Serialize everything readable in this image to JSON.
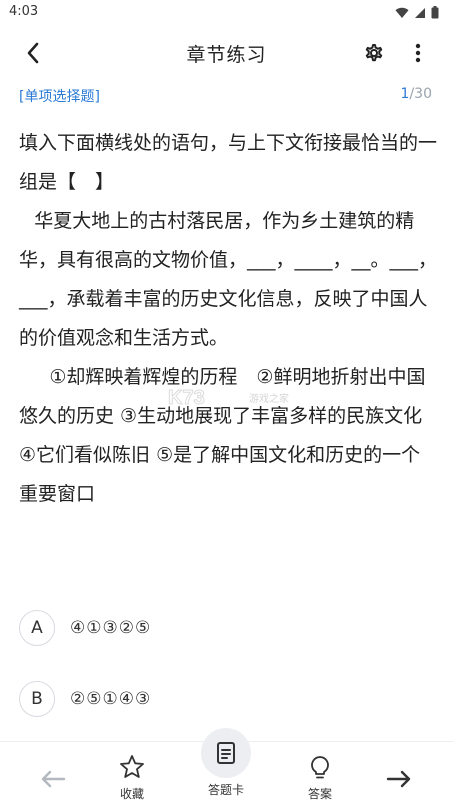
{
  "status_bar": {
    "time": "4:03"
  },
  "header": {
    "title": "章节练习"
  },
  "meta": {
    "question_type": "[单项选择题]",
    "current": "1",
    "total": "/30"
  },
  "question": {
    "paragraphs": [
      "填入下面横线处的语句，与上下文衔接最恰当的一组是【　】",
      "华夏大地上的古村落民居，作为乡土建筑的精华，具有很高的文物价值，___，____，__。___，___，承载着丰富的历史文化信息，反映了中国人的价值观念和生活方式。",
      "①却辉映着辉煌的历程　②鲜明地折射出中国悠久的历史 ③生动地展现了丰富多样的民族文化　④它们看似陈旧 ⑤是了解中国文化和历史的一个重要窗口"
    ]
  },
  "watermark": {
    "text": "游戏之家"
  },
  "options": [
    {
      "letter": "A",
      "text": "④①③②⑤"
    },
    {
      "letter": "B",
      "text": "②⑤①④③"
    }
  ],
  "bottom_nav": {
    "favorite": "收藏",
    "answer_card": "答题卡",
    "answer": "答案"
  },
  "colors": {
    "accent": "#2b7bd6",
    "muted": "#9aa3ad"
  }
}
